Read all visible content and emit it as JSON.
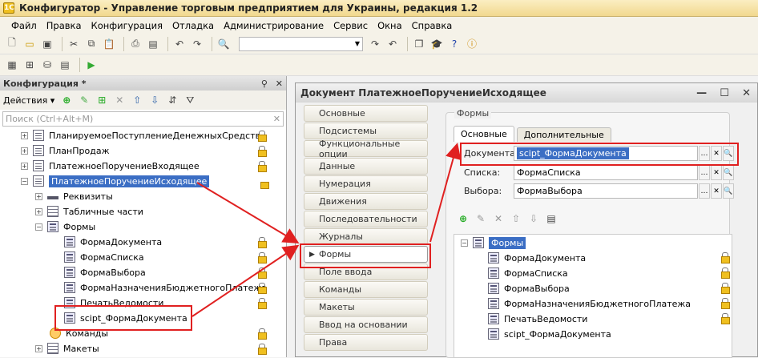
{
  "window": {
    "title": "Конфигуратор - Управление торговым предприятием для Украины, редакция 1.2"
  },
  "menu": [
    "Файл",
    "Правка",
    "Конфигурация",
    "Отладка",
    "Администрирование",
    "Сервис",
    "Окна",
    "Справка"
  ],
  "left_panel": {
    "title": "Конфигурация *",
    "actions_label": "Действия ▾",
    "search_placeholder": "Поиск (Ctrl+Alt+M)",
    "tree": [
      {
        "label": "ПланируемоеПоступлениеДенежныхСредств"
      },
      {
        "label": "ПланПродаж"
      },
      {
        "label": "ПлатежноеПоручениеВходящее"
      },
      {
        "label": "ПлатежноеПоручениеИсходящее"
      },
      {
        "label": "Реквизиты"
      },
      {
        "label": "Табличные части"
      },
      {
        "label": "Формы"
      },
      {
        "label": "ФормаДокумента"
      },
      {
        "label": "ФормаСписка"
      },
      {
        "label": "ФормаВыбора"
      },
      {
        "label": "ФормаНазначенияБюджетногоПлатежа"
      },
      {
        "label": "ПечатьВедомости"
      },
      {
        "label": "scipt_ФормаДокумента"
      },
      {
        "label": "Команды"
      },
      {
        "label": "Макеты"
      }
    ]
  },
  "doc_window": {
    "title": "Документ ПлатежноеПоручениеИсходящее",
    "sections": [
      "Основные",
      "Подсистемы",
      "Функциональные опции",
      "Данные",
      "Нумерация",
      "Движения",
      "Последовательности",
      "Журналы",
      "Формы",
      "Поле ввода",
      "Команды",
      "Макеты",
      "Ввод на основании",
      "Права"
    ],
    "active_section": "Формы",
    "group_title": "Формы",
    "tabs": [
      "Основные",
      "Дополнительные"
    ],
    "fields": [
      {
        "label": "Документа:",
        "value": "scipt_ФормаДокумента"
      },
      {
        "label": "Списка:",
        "value": "ФормаСписка"
      },
      {
        "label": "Выбора:",
        "value": "ФормаВыбора"
      }
    ],
    "forms_tree_root": "Формы",
    "forms_list": [
      "ФормаДокумента",
      "ФормаСписка",
      "ФормаВыбора",
      "ФормаНазначенияБюджетногоПлатежа",
      "ПечатьВедомости",
      "scipt_ФормаДокумента"
    ]
  }
}
